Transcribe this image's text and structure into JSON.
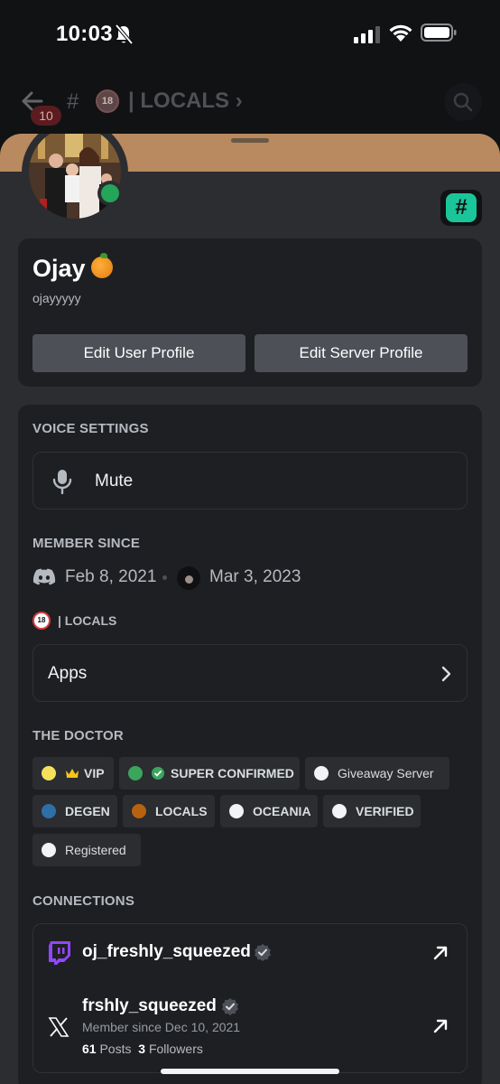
{
  "status_bar": {
    "time": "10:03"
  },
  "background": {
    "badge_count": "10",
    "channel": "| LOCALS",
    "nsfw_label": "18"
  },
  "profile": {
    "display_name": "Ojay",
    "username": "ojayyyyy",
    "buttons": {
      "edit_user": "Edit User Profile",
      "edit_server": "Edit Server Profile"
    },
    "channel_badge": "#"
  },
  "voice": {
    "title": "VOICE SETTINGS",
    "mute_label": "Mute"
  },
  "member_since": {
    "title": "MEMBER SINCE",
    "discord_date": "Feb 8, 2021",
    "server_date": "Mar 3, 2023"
  },
  "server": {
    "name": "| LOCALS",
    "nsfw_label": "18",
    "apps_label": "Apps"
  },
  "roles": {
    "title": "THE DOCTOR",
    "items": [
      {
        "label": "VIP",
        "color": "#f5e05c",
        "icon": "crown-icon"
      },
      {
        "label": "SUPER CONFIRMED",
        "color": "#3ba55c",
        "icon": "check-circle-icon"
      },
      {
        "label": "Giveaway Server",
        "color": "#f2f3f5"
      },
      {
        "label": "DEGEN",
        "color": "#2f6fa8"
      },
      {
        "label": "LOCALS",
        "color": "#b8620f"
      },
      {
        "label": "OCEANIA",
        "color": "#f2f3f5"
      },
      {
        "label": "VERIFIED",
        "color": "#f2f3f5"
      },
      {
        "label": "Registered",
        "color": "#f2f3f5"
      }
    ]
  },
  "connections": {
    "title": "CONNECTIONS",
    "items": [
      {
        "service": "twitch",
        "name": "oj_freshly_squeezed"
      },
      {
        "service": "x",
        "name": "frshly_squeezed",
        "member_since": "Member since Dec 10, 2021",
        "posts_count": "61",
        "posts_label": "Posts",
        "followers_count": "3",
        "followers_label": "Followers"
      }
    ]
  },
  "colors": {
    "accent_green": "#23a55a",
    "banner": "#b98a5f",
    "twitch": "#9146ff"
  }
}
